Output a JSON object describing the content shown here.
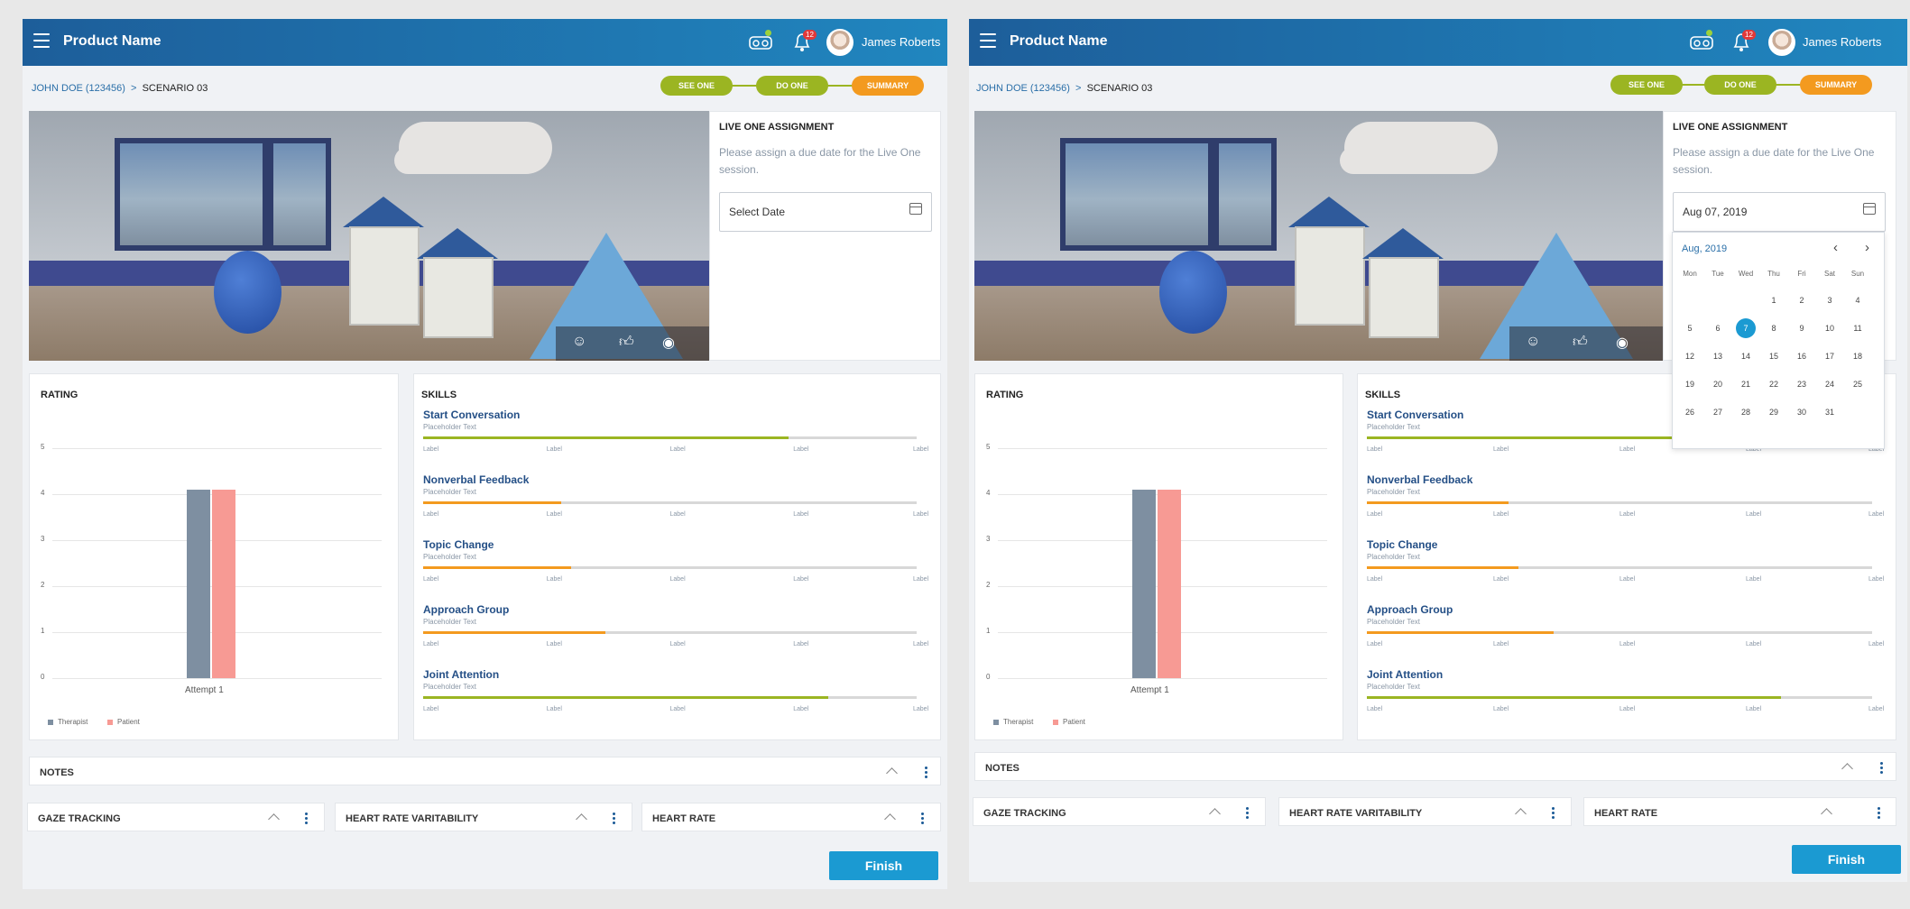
{
  "app": {
    "name": "Product Name",
    "notification_count": "12",
    "user_name": "James Roberts"
  },
  "breadcrumb": {
    "patient": "JOHN DOE (123456)",
    "scenario": "SCENARIO 03"
  },
  "steps": [
    {
      "label": "SEE ONE",
      "color": "#9bb522"
    },
    {
      "label": "DO ONE",
      "color": "#9bb522"
    },
    {
      "label": "SUMMARY",
      "color": "#f39a1f"
    }
  ],
  "assignment": {
    "title": "LIVE ONE ASSIGNMENT",
    "instruction": "Please assign a due date for the Live One session.",
    "left_date_placeholder": "Select Date",
    "right_date_value": "Aug 07, 2019"
  },
  "calendar": {
    "month": "Aug, 2019",
    "weekdays": [
      "Mon",
      "Tue",
      "Wed",
      "Thu",
      "Fri",
      "Sat",
      "Sun"
    ],
    "weeks": [
      [
        "",
        "",
        "",
        "1",
        "2",
        "3",
        "4"
      ],
      [
        "5",
        "6",
        "7",
        "8",
        "9",
        "10",
        "11"
      ],
      [
        "12",
        "13",
        "14",
        "15",
        "16",
        "17",
        "18"
      ],
      [
        "19",
        "20",
        "21",
        "22",
        "23",
        "24",
        "25"
      ],
      [
        "26",
        "27",
        "28",
        "29",
        "30",
        "31",
        ""
      ]
    ],
    "selected": "7"
  },
  "rating": {
    "title": "RATING"
  },
  "chart_data": {
    "type": "bar",
    "categories": [
      "Attempt 1"
    ],
    "series": [
      {
        "name": "Therapist",
        "values": [
          4.1
        ],
        "color": "#7e8fa1"
      },
      {
        "name": "Patient",
        "values": [
          4.1
        ],
        "color": "#f79a94"
      }
    ],
    "ylim": [
      0,
      5
    ],
    "yticks": [
      "0",
      "1",
      "2",
      "3",
      "4",
      "5"
    ],
    "legend": "bottom-left"
  },
  "skills": {
    "title": "SKILLS",
    "tick_label": "Label",
    "items": [
      {
        "name": "Start Conversation",
        "sub": "Placeholder Text",
        "progress": 0.74,
        "color": "#9bb522"
      },
      {
        "name": "Nonverbal Feedback",
        "sub": "Placeholder Text",
        "progress": 0.28,
        "color": "#f39a1f"
      },
      {
        "name": "Topic Change",
        "sub": "Placeholder Text",
        "progress": 0.3,
        "color": "#f39a1f"
      },
      {
        "name": "Approach Group",
        "sub": "Placeholder Text",
        "progress": 0.37,
        "color": "#f39a1f"
      },
      {
        "name": "Joint Attention",
        "sub": "Placeholder Text",
        "progress": 0.82,
        "color": "#9bb522"
      }
    ]
  },
  "panels": {
    "notes": "NOTES",
    "gaze": "GAZE TRACKING",
    "hrv": "HEART RATE VARITABILITY",
    "hr": "HEART RATE"
  },
  "finish_label": "Finish"
}
